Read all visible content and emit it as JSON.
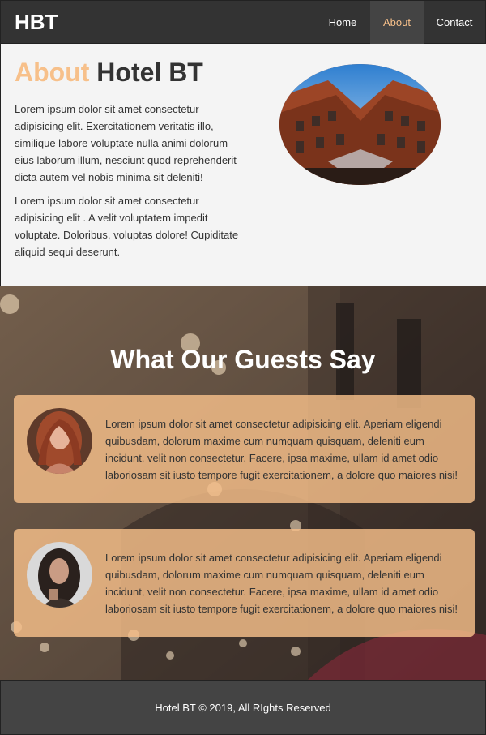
{
  "navbar": {
    "brand": "HBT",
    "links": [
      {
        "label": "Home",
        "active": false
      },
      {
        "label": "About",
        "active": true
      },
      {
        "label": "Contact",
        "active": false
      }
    ]
  },
  "about": {
    "title_accent": "About",
    "title_rest": "Hotel BT",
    "paragraphs": [
      "Lorem ipsum dolor sit amet consectetur adipisicing elit. Exercitationem veritatis illo, similique labore voluptate nulla animi dolorum eius laborum illum, nesciunt quod reprehenderit dicta autem vel nobis minima sit deleniti!",
      "Lorem ipsum dolor sit amet consectetur adipisicing elit . A velit voluptatem impedit voluptate. Doloribus, voluptas dolore! Cupiditate aliquid sequi deserunt."
    ]
  },
  "testimonials": {
    "heading": "What Our Guests Say",
    "items": [
      {
        "text": "Lorem ipsum dolor sit amet consectetur adipisicing elit. Aperiam eligendi quibusdam, dolorum maxime cum numquam quisquam, deleniti eum incidunt, velit non consectetur. Facere, ipsa maxime, ullam id amet odio laboriosam sit iusto tempore fugit exercitationem, a dolore quo maiores nisi!"
      },
      {
        "text": "Lorem ipsum dolor sit amet consectetur adipisicing elit. Aperiam eligendi quibusdam, dolorum maxime cum numquam quisquam, deleniti eum incidunt, velit non consectetur. Facere, ipsa maxime, ullam id amet odio laboriosam sit iusto tempore fugit exercitationem, a dolore quo maiores nisi!"
      }
    ]
  },
  "footer": {
    "text": "Hotel BT © 2019, All RIghts Reserved"
  },
  "colors": {
    "accent": "#f7c08a",
    "navbar_bg": "#333333",
    "footer_bg": "#444444",
    "card_bg": "#f7c08a"
  }
}
